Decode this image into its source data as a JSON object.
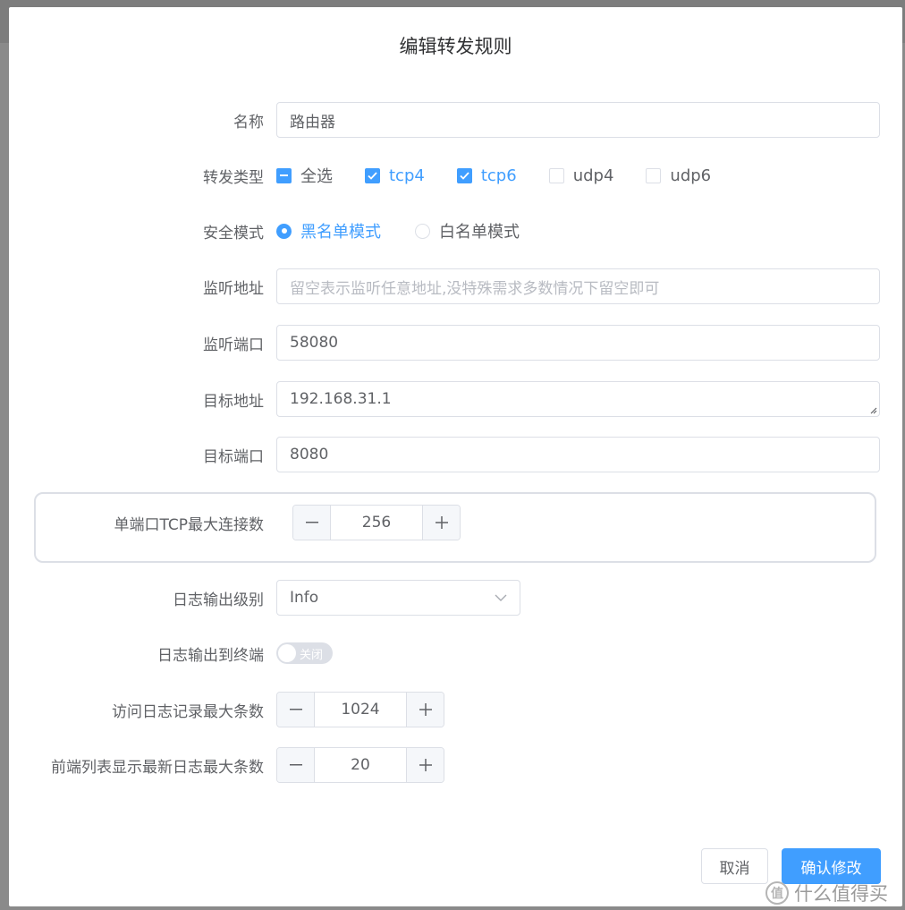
{
  "dialog": {
    "title": "编辑转发规则",
    "cancel_label": "取消",
    "confirm_label": "确认修改"
  },
  "form": {
    "name": {
      "label": "名称",
      "value": "路由器"
    },
    "forward_type": {
      "label": "转发类型",
      "options": [
        {
          "label": "全选",
          "state": "indeterminate"
        },
        {
          "label": "tcp4",
          "state": "checked"
        },
        {
          "label": "tcp6",
          "state": "checked"
        },
        {
          "label": "udp4",
          "state": "unchecked"
        },
        {
          "label": "udp6",
          "state": "unchecked"
        }
      ]
    },
    "security_mode": {
      "label": "安全模式",
      "options": [
        {
          "label": "黑名单模式",
          "selected": true
        },
        {
          "label": "白名单模式",
          "selected": false
        }
      ]
    },
    "listen_address": {
      "label": "监听地址",
      "value": "",
      "placeholder": "留空表示监听任意地址,没特殊需求多数情况下留空即可"
    },
    "listen_port": {
      "label": "监听端口",
      "value": "58080"
    },
    "target_address": {
      "label": "目标地址",
      "value": "192.168.31.1"
    },
    "target_port": {
      "label": "目标端口",
      "value": "8080"
    },
    "tcp_max_conn": {
      "label": "单端口TCP最大连接数",
      "value": "256"
    },
    "log_level": {
      "label": "日志输出级别",
      "value": "Info"
    },
    "log_to_terminal": {
      "label": "日志输出到终端",
      "switch_text": "关闭",
      "on": false
    },
    "access_log_max": {
      "label": "访问日志记录最大条数",
      "value": "1024"
    },
    "frontend_log_max": {
      "label": "前端列表显示最新日志最大条数",
      "value": "20"
    }
  },
  "watermark": {
    "text": "什么值得买",
    "mark": "值"
  },
  "colors": {
    "primary": "#409eff",
    "border": "#dcdfe6",
    "text": "#606266",
    "overlay": "#8a8a8a"
  }
}
